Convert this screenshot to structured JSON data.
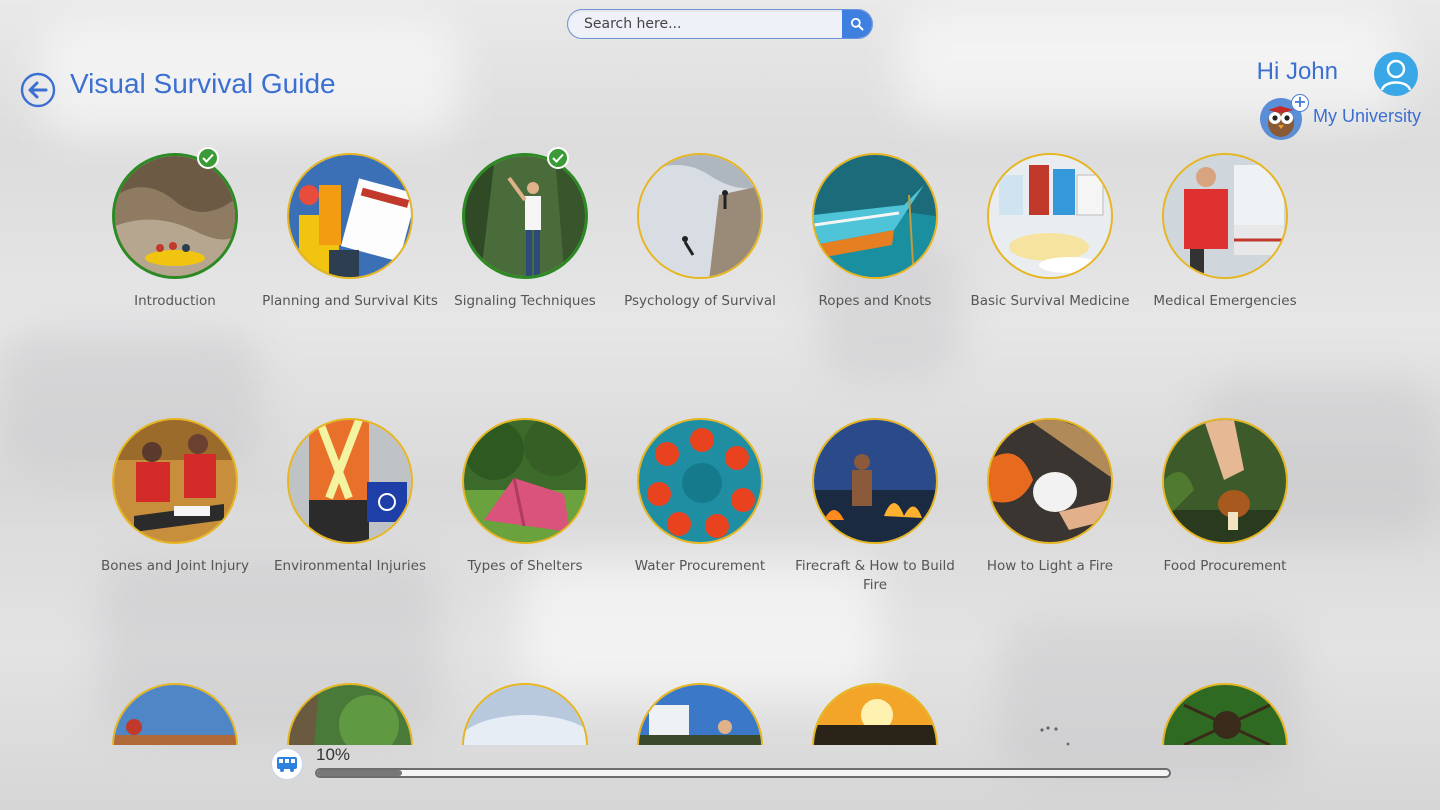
{
  "app": {
    "title": "Visual Survival Guide",
    "accent_color": "#3b6fd1",
    "completed_color": "#2c8a23",
    "ring_color": "#e7b51e"
  },
  "search": {
    "placeholder": "Search here...",
    "button_icon": "search-icon"
  },
  "header": {
    "back_icon": "arrow-left-icon",
    "greeting": "Hi John",
    "avatar_icon": "user-icon",
    "university_label": "My University",
    "university_icon": "owl-mascot-icon"
  },
  "topics": [
    {
      "label": "Introduction",
      "completed": true
    },
    {
      "label": "Planning and Survival Kits",
      "completed": false
    },
    {
      "label": "Signaling Techniques",
      "completed": true
    },
    {
      "label": "Psychology of Survival",
      "completed": false
    },
    {
      "label": "Ropes and Knots",
      "completed": false
    },
    {
      "label": "Basic Survival Medicine",
      "completed": false
    },
    {
      "label": "Medical Emergencies",
      "completed": false
    },
    {
      "label": "Bones and Joint Injury",
      "completed": false
    },
    {
      "label": "Environmental Injuries",
      "completed": false
    },
    {
      "label": "Types of Shelters",
      "completed": false
    },
    {
      "label": "Water Procurement",
      "completed": false
    },
    {
      "label": "Firecraft & How to Build Fire",
      "completed": false
    },
    {
      "label": "How to Light a Fire",
      "completed": false
    },
    {
      "label": "Food Procurement",
      "completed": false
    }
  ],
  "progress": {
    "text": "10%",
    "value": 0.1,
    "icon": "bus-icon"
  }
}
